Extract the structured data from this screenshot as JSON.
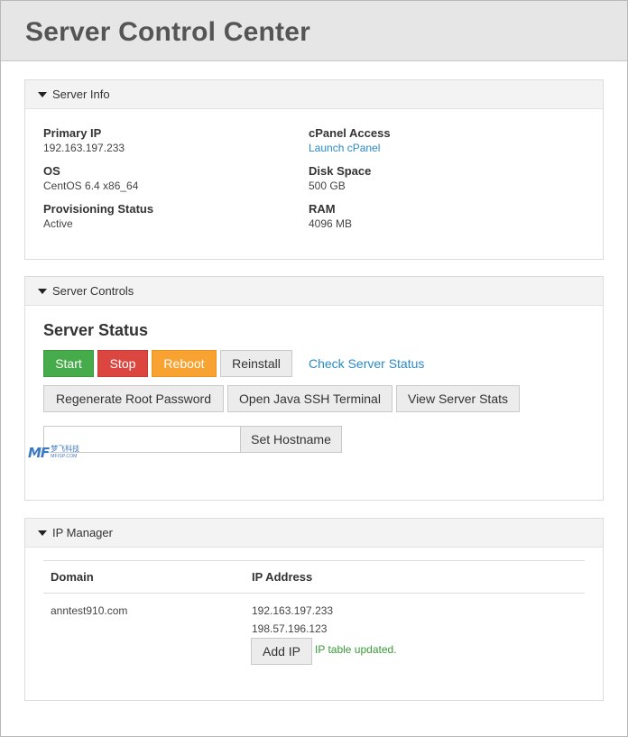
{
  "header": {
    "title": "Server Control Center"
  },
  "server_info": {
    "heading": "Server Info",
    "fields": {
      "primary_ip_label": "Primary IP",
      "primary_ip_value": "192.163.197.233",
      "os_label": "OS",
      "os_value": "CentOS 6.4 x86_64",
      "provisioning_label": "Provisioning Status",
      "provisioning_value": "Active",
      "cpanel_label": "cPanel Access",
      "cpanel_link": "Launch cPanel",
      "disk_label": "Disk Space",
      "disk_value": "500 GB",
      "ram_label": "RAM",
      "ram_value": "4096 MB"
    }
  },
  "server_controls": {
    "heading": "Server Controls",
    "status_title": "Server Status",
    "buttons": {
      "start": "Start",
      "stop": "Stop",
      "reboot": "Reboot",
      "reinstall": "Reinstall",
      "check_status": "Check Server Status",
      "regenerate_password": "Regenerate Root Password",
      "java_ssh": "Open Java SSH Terminal",
      "server_stats": "View Server Stats",
      "set_hostname": "Set Hostname"
    },
    "hostname_value": "",
    "colors": {
      "start": "#46ab4a",
      "stop": "#dc4641",
      "reboot": "#f8a331",
      "link": "#2a8ac6"
    }
  },
  "ip_manager": {
    "heading": "IP Manager",
    "columns": {
      "domain": "Domain",
      "ip_address": "IP Address"
    },
    "rows": [
      {
        "domain": "anntest910.com",
        "ips": [
          "192.163.197.233",
          "198.57.196.123"
        ]
      }
    ],
    "add_ip_label": "Add IP",
    "status_message": "IP table updated."
  },
  "watermark": {
    "logo": "MF",
    "cn": "梦飞科技",
    "en": "MFISP.COM"
  }
}
